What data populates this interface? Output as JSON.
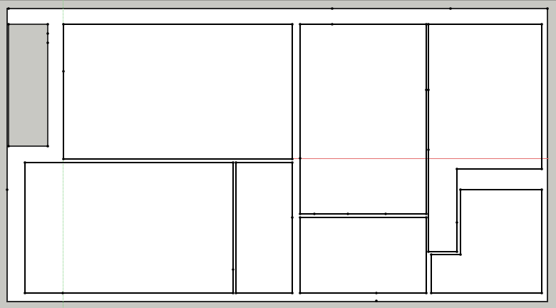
{
  "colors": {
    "workspace_background": "#c8c8c3",
    "sheet_background": "#ffffff",
    "shaded_room_fill": "#c8c8c3",
    "wall_stroke": "#000000",
    "sheet_border": "#2b2b2b",
    "guide_horizontal": "#e57070",
    "guide_vertical": "#7ccf7c",
    "vertex_marker": "#000000"
  },
  "guides": {
    "horizontal_guide": "red-horizontal-guide",
    "vertical_guide": "green-vertical-guide"
  },
  "elements": [
    "room-shaded-left",
    "room-top-left-large",
    "room-bottom-left-large",
    "room-bottom-left-narrow",
    "room-center-tall",
    "room-center-bottom",
    "room-right-l-shaped-outline",
    "room-right-bottom-stepped"
  ]
}
